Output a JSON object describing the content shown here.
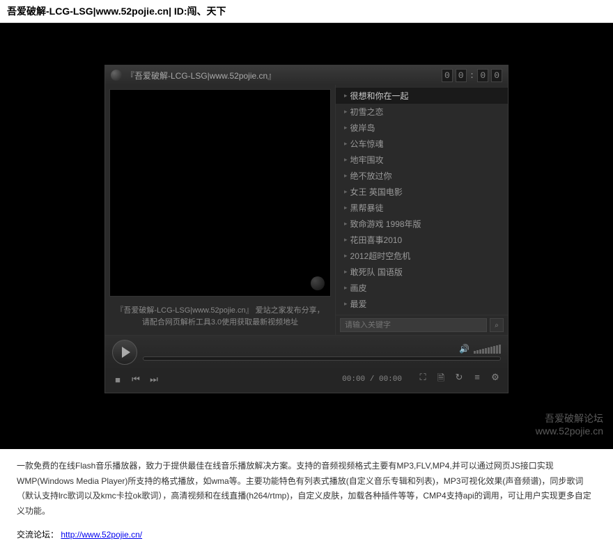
{
  "page": {
    "title": "吾爱破解-LCG-LSG|www.52pojie.cn| ID:闯、天下"
  },
  "player": {
    "titlebar": "『吾爱破解-LCG-LSG|www.52pojie.cn』",
    "clock": {
      "h1": "0",
      "h2": "0",
      "m1": "0",
      "m2": "0"
    },
    "caption": "『吾爱破解-LCG-LSG|www.52pojie.cn』 爱站之家发布分享，请配合网页解析工具3.0使用获取最新视频地址",
    "time": {
      "current": "00:00",
      "total": "00:00"
    },
    "search_placeholder": "请输入关键字"
  },
  "playlist": [
    {
      "label": "很想和你在一起",
      "active": true
    },
    {
      "label": "初雪之恋"
    },
    {
      "label": "彼岸岛"
    },
    {
      "label": "公车惊魂"
    },
    {
      "label": "地牢围攻"
    },
    {
      "label": "绝不放过你"
    },
    {
      "label": "女王 英国电影"
    },
    {
      "label": "黑帮暴徒"
    },
    {
      "label": "致命游戏 1998年版"
    },
    {
      "label": "花田喜事2010"
    },
    {
      "label": "2012超时空危机"
    },
    {
      "label": "敢死队 国语版"
    },
    {
      "label": "画皮"
    },
    {
      "label": "最爱"
    }
  ],
  "description": {
    "text": "一款免费的在线Flash音乐播放器，致力于提供最佳在线音乐播放解决方案。支持的音频视频格式主要有MP3,FLV,MP4,并可以通过网页JS接口实现WMP(Windows Media Player)所支持的格式播放，如wma等。主要功能特色有列表式播放(自定义音乐专辑和列表)，MP3可视化效果(声音频谱)，同步歌词（默认支持lrc歌词以及kmc卡拉ok歌词），高清视频和在线直播(h264/rtmp)，自定义皮肤，加载各种插件等等，CMP4支持api的调用，可让用户实现更多自定义功能。"
  },
  "forum": {
    "label": "交流论坛：",
    "url": "http://www.52pojie.cn/"
  },
  "watermark": {
    "line1": "吾爱破解论坛",
    "line2": "www.52pojie.cn"
  }
}
